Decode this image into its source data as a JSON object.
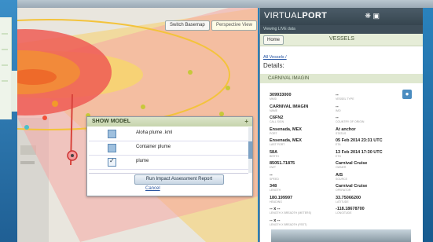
{
  "map": {
    "basemap_button": "Switch Basemap",
    "perspective_button": "Perspective View"
  },
  "show_model": {
    "title": "SHOW MODEL",
    "plus_glyph": "+",
    "items": [
      {
        "label": "Aloha plume .kml",
        "checked": false
      },
      {
        "label": "Container plume",
        "checked": false
      },
      {
        "label": "plume",
        "checked": true
      }
    ],
    "run_button": "Run Impact Assessment Report",
    "cancel_link": "Cancel"
  },
  "panel": {
    "logo_virtual": "VIRTUAL",
    "logo_port": "PORT",
    "subheader": "Viewing LIVE data",
    "home_button": "Home",
    "nav_title": "VESSELS",
    "breadcrumb": "All Vessels /",
    "details_heading": "Details:",
    "vessel_name": "CARNIVAL IMAGIN",
    "pin_icon": "map-pin-icon",
    "left_fields": [
      {
        "value": "309933000",
        "label": "MMSI"
      },
      {
        "value": "CARNIVAL IMAGIN",
        "label": "NAME"
      },
      {
        "value": "C6FN2",
        "label": "CALL SIGN"
      },
      {
        "value": "Ensenada, MEX",
        "label": "PORT"
      },
      {
        "value": "Ensenada, MEX",
        "label": "LAST PORT"
      },
      {
        "value": "58A",
        "label": "BERTH"
      },
      {
        "value": "85051.71875",
        "label": "DWT"
      },
      {
        "value": "--",
        "label": "SPEED"
      },
      {
        "value": "348",
        "label": "LENGTH"
      },
      {
        "value": "180.199997",
        "label": "HEADING"
      },
      {
        "value": "-- x --",
        "label": "LENGTH X BREADTH (METERS)"
      },
      {
        "value": "-- x --",
        "label": "LENGTH X BREADTH (FEET)"
      }
    ],
    "right_fields": [
      {
        "value": "--",
        "label": "VESSEL TYPE"
      },
      {
        "value": "--",
        "label": "IMO"
      },
      {
        "value": "--",
        "label": "COUNTRY OF ORIGIN"
      },
      {
        "value": "At anchor",
        "label": "STATUS"
      },
      {
        "value": "05 Feb 2014 23:31 UTC",
        "label": "ETA"
      },
      {
        "value": "13 Feb 2014 17:30 UTC",
        "label": "ETD"
      },
      {
        "value": "Carnival Cruise",
        "label": "OWNER"
      },
      {
        "value": "AIS",
        "label": "SOURCE"
      },
      {
        "value": "Carnival Cruise",
        "label": "OPERATOR"
      },
      {
        "value": "33.75066200",
        "label": "LATITUDE"
      },
      {
        "value": "-118.18678700",
        "label": "LONGITUDE"
      }
    ]
  }
}
